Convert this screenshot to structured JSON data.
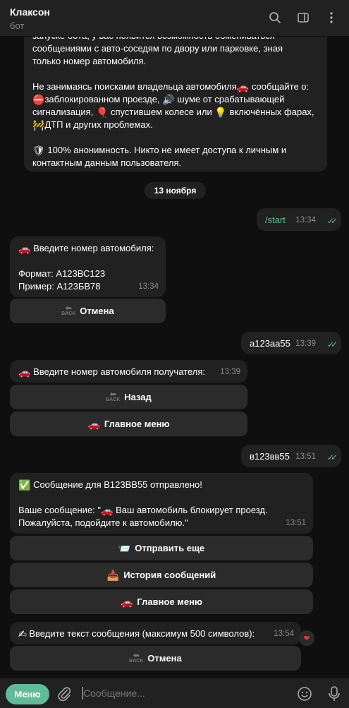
{
  "header": {
    "title": "Клаксон",
    "subtitle": "бот"
  },
  "intro": {
    "line1": "запуске бота, у вас появится возможность обмениваться",
    "line2": "сообщениями с авто-соседям по двору или парковке, зная",
    "line3": "только номер автомобиля.",
    "para2_a": "Не занимаясь поисками владельца автомобиля",
    "para2_b": " сообщайте о:",
    "para2_c": "заблокированном проезде,",
    "para2_d": " шуме от срабатывающей",
    "para2_e": "сигнализация,",
    "para2_f": " спустившем колесе или",
    "para2_g": " включённых фарах,",
    "para2_h": "ДТП и других проблемах.",
    "para3_a": "100% анонимность. Никто не имеет доступа к личным и",
    "para3_b": "контактным данным пользователя."
  },
  "date_separator": "13 ноября",
  "messages": {
    "start": {
      "text": "/start",
      "time": "13:34"
    },
    "enter_number": {
      "line1": "Введите номер автомобиля:",
      "line2": "Формат: А123ВС123",
      "line3": "Пример: А123БВ78",
      "time": "13:34"
    },
    "cancel1": "Отмена",
    "user_a123": {
      "text": "а123аа55",
      "time": "13:39"
    },
    "enter_recipient": {
      "text": "Введите номер автомобиля получателя:",
      "time": "13:39"
    },
    "back": "Назад",
    "main_menu1": "Главное меню",
    "user_b123": {
      "text": "в123вв55",
      "time": "13:51"
    },
    "sent": {
      "line1": "Сообщение для В123ВВ55 отправлено!",
      "line2": "Ваше сообщение: \"",
      "line2b": " Ваш автомобиль блокирует проезд.",
      "line3": "Пожалуйста, подойдите к автомобилю.\"",
      "time": "13:51"
    },
    "send_more": "Отправить еще",
    "history": "История сообщений",
    "main_menu2": "Главное меню",
    "enter_text": {
      "text": "Введите текст сообщения (максимум 500 символов):",
      "time": "13:54"
    },
    "cancel2": "Отмена"
  },
  "input": {
    "menu_label": "Меню",
    "placeholder": "Сообщение..."
  },
  "icons": {
    "back_small": "BACK",
    "ticks": "✓✓"
  },
  "colors": {
    "accent": "#5fbb98",
    "bubble": "#212121",
    "button": "#2b2b2b",
    "background": "#0f0f0f"
  }
}
